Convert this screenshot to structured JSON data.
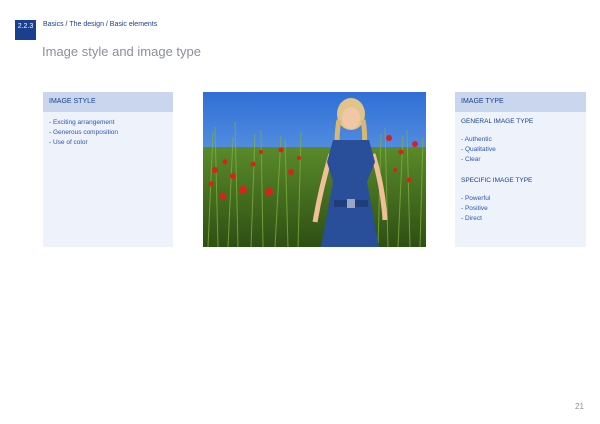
{
  "header": {
    "section_number": "2.2.3",
    "breadcrumb": "Basics / The design / Basic elements",
    "title": "Image style and image type"
  },
  "image_style": {
    "heading": "IMAGE STYLE",
    "items": [
      "- Exciting arrangement",
      "- Generous composition",
      "- Use of color"
    ]
  },
  "image_type": {
    "heading": "IMAGE TYPE",
    "general_heading": "GENERAL IMAGE TYPE",
    "general_items": [
      "- Authentic",
      "- Qualitative",
      "- Clear"
    ],
    "specific_heading": "SPECIFIC IMAGE TYPE",
    "specific_items": [
      "- Powerful",
      "- Positive",
      "- Direct"
    ]
  },
  "footer": {
    "page_number": "21"
  },
  "colors": {
    "brand_blue": "#1a3f8f",
    "panel_bg": "#eef2fb",
    "panel_header_bg": "#c9d6ee"
  }
}
